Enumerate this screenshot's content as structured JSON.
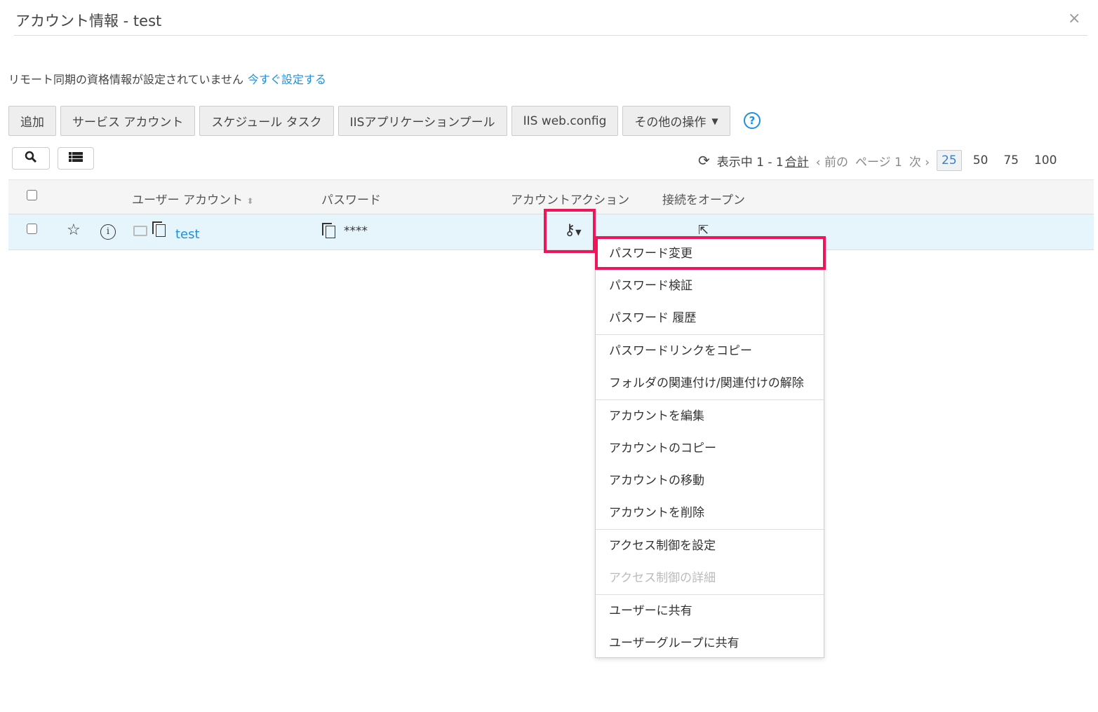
{
  "dialog": {
    "title": "アカウント情報 - test",
    "close": "×"
  },
  "notice": {
    "text": "リモート同期の資格情報が設定されていません",
    "link": "今すぐ設定する"
  },
  "toolbar": {
    "buttons": [
      "追加",
      "サービス アカウント",
      "スケジュール タスク",
      "IISアプリケーションプール",
      "IIS web.config",
      "その他の操作"
    ],
    "help": "?"
  },
  "pager": {
    "status": "表示中 1 - 1",
    "total": "合計",
    "prev": "前の",
    "page": "ページ 1",
    "next": "次",
    "sizes": [
      "25",
      "50",
      "75",
      "100"
    ],
    "selected_size": "25"
  },
  "table": {
    "headers": [
      "ユーザー アカウント",
      "パスワード",
      "アカウントアクション",
      "接続をオープン"
    ],
    "rows": [
      {
        "account": "test",
        "password": "****"
      }
    ]
  },
  "menu": {
    "items": [
      {
        "label": "パスワード変更"
      },
      {
        "label": "パスワード検証"
      },
      {
        "label": "パスワード 履歴"
      },
      {
        "label": "パスワードリンクをコピー"
      },
      {
        "label": "フォルダの関連付け/関連付けの解除"
      },
      {
        "label": "アカウントを編集"
      },
      {
        "label": "アカウントのコピー"
      },
      {
        "label": "アカウントの移動"
      },
      {
        "label": "アカウントを削除"
      },
      {
        "label": "アクセス制御を設定"
      },
      {
        "label": "アクセス制御の詳細"
      },
      {
        "label": "ユーザーに共有"
      },
      {
        "label": "ユーザーグループに共有"
      }
    ]
  },
  "colors": {
    "highlight": "#f0145a",
    "link": "#1e90e0",
    "row": "#e6f4fc"
  }
}
